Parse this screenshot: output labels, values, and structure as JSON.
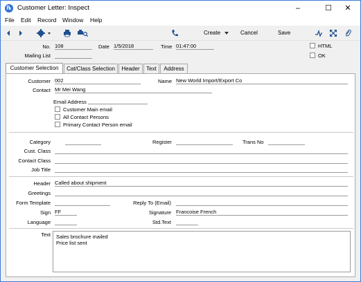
{
  "window": {
    "title": "Customer Letter: Inspect",
    "controls": {
      "minimize": "–",
      "maximize": "☐",
      "close": "✕"
    }
  },
  "menu": [
    "File",
    "Edit",
    "Record",
    "Window",
    "Help"
  ],
  "toolbar": {
    "create_label": "Create",
    "cancel_label": "Cancel",
    "save_label": "Save"
  },
  "header": {
    "no_label": "No.",
    "no_value": "108",
    "date_label": "Date",
    "date_value": "1/5/2018",
    "time_label": "Time",
    "time_value": "01:47:00",
    "mailing_list_label": "Mailing List",
    "mailing_list_value": "",
    "html_label": "HTML",
    "ok_label": "OK"
  },
  "tabs": [
    "Customer Selection",
    "Cat/Class Selection",
    "Header",
    "Text",
    "Address"
  ],
  "customer": {
    "customer_label": "Customer",
    "customer_value": "002",
    "name_label": "Name",
    "name_value": "New World Import/Export Co",
    "contact_label": "Contact",
    "contact_value": "Mr Mei Wang",
    "email_label": "Email Address",
    "email_value": "",
    "cb_main_email": "Customer Main email",
    "cb_all_contacts": "All Contact Persons",
    "cb_primary_contact": "Primary Contact Person email"
  },
  "classification": {
    "category_label": "Category",
    "register_label": "Register",
    "trans_no_label": "Trans No",
    "cust_class_label": "Cust. Class",
    "contact_class_label": "Contact Class",
    "job_title_label": "Job Title"
  },
  "letter": {
    "header_label": "Header",
    "header_value": "Called about shipment",
    "greetings_label": "Greetings",
    "form_template_label": "Form Template",
    "reply_to_label": "Reply To (Email)",
    "sign_label": "Sign",
    "sign_value": "FF",
    "signature_label": "Signature",
    "signature_value": "Francoise French",
    "language_label": "Language",
    "std_text_label": "Std.Text",
    "text_label": "Text",
    "text_lines": [
      "Sales brochure mailed",
      "Price list sent"
    ]
  }
}
